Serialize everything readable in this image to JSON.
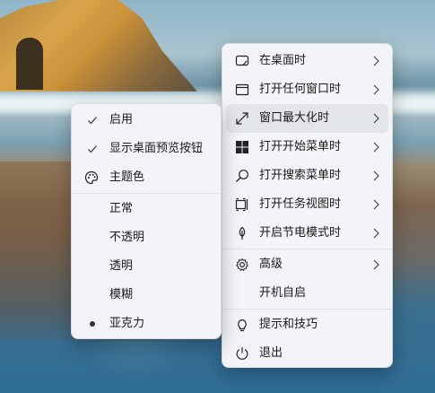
{
  "main_menu": {
    "items": [
      {
        "label": "在桌面时",
        "icon": "desktop-icon"
      },
      {
        "label": "打开任何窗口时",
        "icon": "window-icon"
      },
      {
        "label": "窗口最大化时",
        "icon": "maximize-icon"
      },
      {
        "label": "打开开始菜单时",
        "icon": "windows-logo-icon"
      },
      {
        "label": "打开搜索菜单时",
        "icon": "search-icon"
      },
      {
        "label": "打开任务视图时",
        "icon": "task-view-icon"
      },
      {
        "label": "开启节电模式时",
        "icon": "leaf-icon"
      },
      {
        "label": "高级",
        "icon": "gear-icon"
      },
      {
        "label": "开机自启"
      },
      {
        "label": "提示和技巧",
        "icon": "lightbulb-icon"
      },
      {
        "label": "退出",
        "icon": "power-icon"
      }
    ]
  },
  "sub_menu": {
    "items": [
      {
        "label": "启用",
        "checked": true
      },
      {
        "label": "显示桌面预览按钮",
        "checked": true
      },
      {
        "label": "主题色",
        "icon": "palette-icon"
      },
      {
        "label": "正常"
      },
      {
        "label": "不透明"
      },
      {
        "label": "透明"
      },
      {
        "label": "模糊"
      },
      {
        "label": "亚克力",
        "selected": true
      }
    ]
  }
}
